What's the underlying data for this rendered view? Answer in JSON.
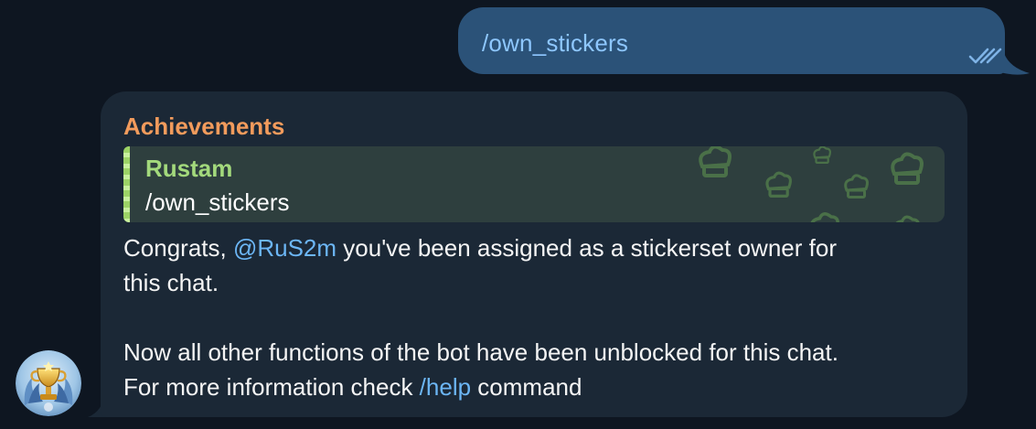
{
  "outgoing": {
    "text": "/own_stickers",
    "status_icon": "double-check-icon"
  },
  "incoming": {
    "sender": "Achievements",
    "reply": {
      "author": "Rustam",
      "text": "/own_stickers"
    },
    "message": {
      "line1_prefix": "Congrats, ",
      "mention": "@RuS2m",
      "line1_suffix": " you've been assigned as a stickerset owner for",
      "line2": "this chat.",
      "line3": "Now all other functions of the bot have been unblocked for this chat.",
      "line4_prefix": "For more information check ",
      "command": "/help",
      "line4_suffix": " command"
    },
    "avatar_icon": "trophy-icon"
  },
  "colors": {
    "background": "#0e1621",
    "outgoing_bubble": "#2b5278",
    "incoming_bubble": "#1b2836",
    "sender_name": "#f29b5c",
    "reply_author": "#a3d97c",
    "link": "#6cb6f5"
  }
}
